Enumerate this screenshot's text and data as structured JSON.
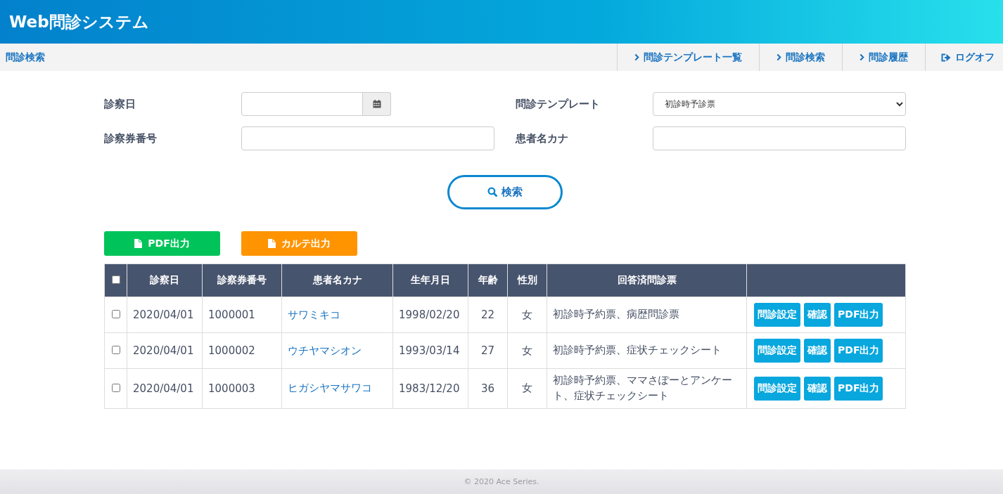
{
  "header": {
    "title": "Web問診システム"
  },
  "navbar": {
    "page_title": "問診検索",
    "links": [
      {
        "label": "問診テンプレート一覧",
        "kind": "link"
      },
      {
        "label": "問診検索",
        "kind": "link"
      },
      {
        "label": "問診履歴",
        "kind": "link"
      },
      {
        "label": "ログオフ",
        "kind": "logout"
      }
    ]
  },
  "search_form": {
    "fields": [
      {
        "label": "診察日",
        "kind": "date"
      },
      {
        "label": "問診テンプレート",
        "kind": "select",
        "value": "初診時予診票"
      },
      {
        "label": "診察券番号",
        "kind": "text"
      },
      {
        "label": "患者名カナ",
        "kind": "text"
      }
    ],
    "search_button": "検索"
  },
  "export_buttons": [
    {
      "label": "PDF出力",
      "kind": "pdf"
    },
    {
      "label": "カルテ出力",
      "kind": "karte"
    }
  ],
  "table": {
    "select_all_checked": false,
    "columns": [
      "診察日",
      "診察券番号",
      "患者名カナ",
      "生年月日",
      "年齢",
      "性別",
      "回答済問診票"
    ],
    "rows": [
      {
        "checked": false,
        "date": "2020/04/01",
        "card_no": "1000001",
        "name": "サワミキコ",
        "birth": "1998/02/20",
        "age": "22",
        "sex": "女",
        "answered": "初診時予約票、病歴問診票",
        "actions": [
          "問診設定",
          "確認",
          "PDF出力"
        ]
      },
      {
        "checked": false,
        "date": "2020/04/01",
        "card_no": "1000002",
        "name": "ウチヤマシオン",
        "birth": "1993/03/14",
        "age": "27",
        "sex": "女",
        "answered": "初診時予約票、症状チェックシート",
        "actions": [
          "問診設定",
          "確認",
          "PDF出力"
        ]
      },
      {
        "checked": false,
        "date": "2020/04/01",
        "card_no": "1000003",
        "name": "ヒガシヤマサワコ",
        "birth": "1983/12/20",
        "age": "36",
        "sex": "女",
        "answered": "初診時予約票、ママさぽーとアンケート、症状チェックシート",
        "actions": [
          "問診設定",
          "確認",
          "PDF出力"
        ]
      }
    ]
  },
  "footer": {
    "copyright": "© 2020 Ace Series."
  }
}
